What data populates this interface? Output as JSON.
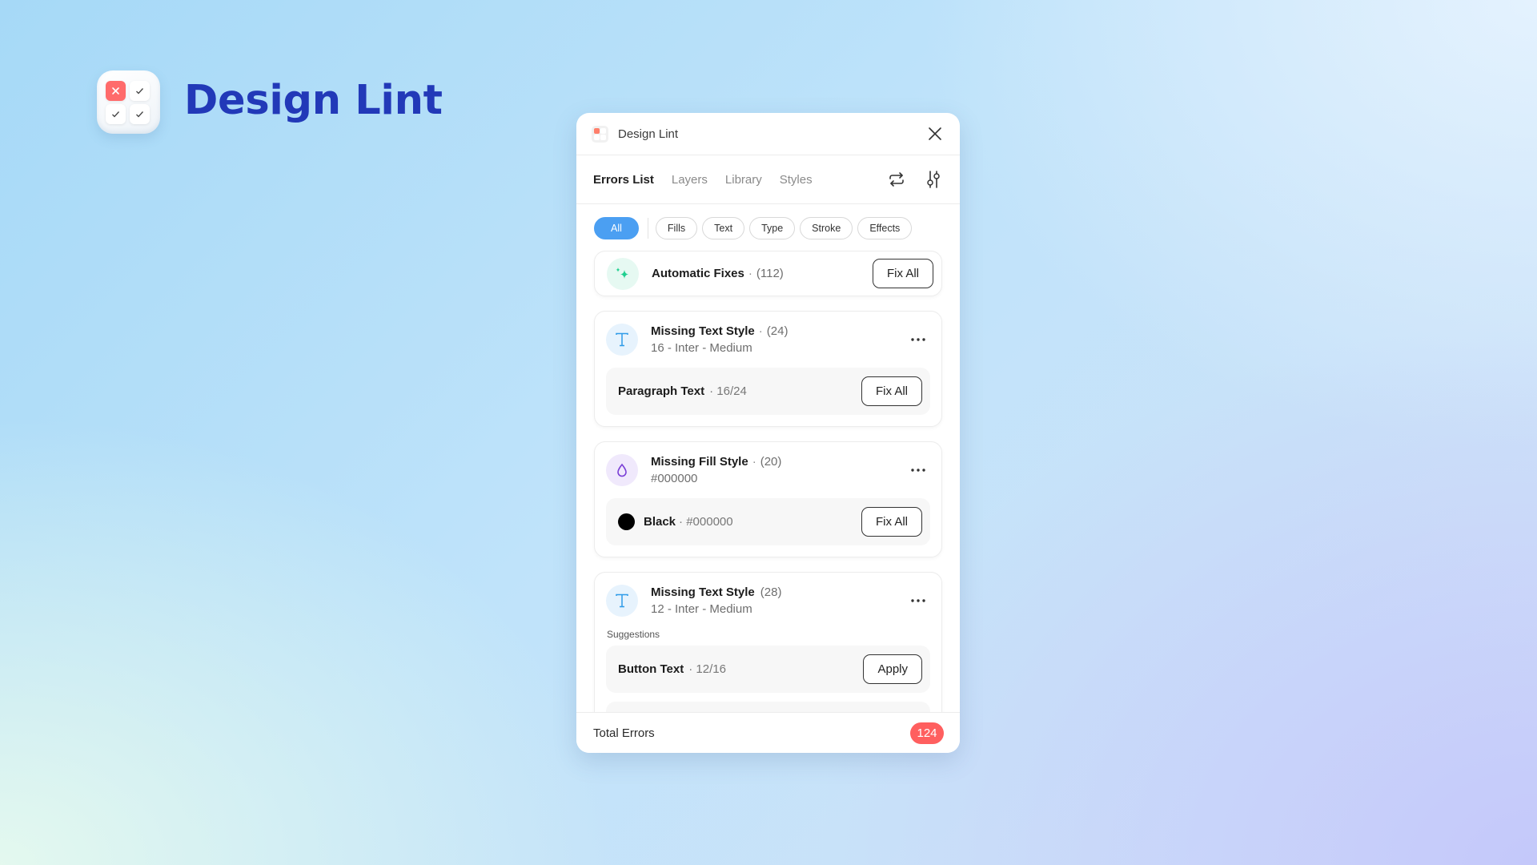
{
  "brand": {
    "title": "Design Lint"
  },
  "panel": {
    "title": "Design Lint",
    "tabs": [
      {
        "label": "Errors List",
        "active": true
      },
      {
        "label": "Layers",
        "active": false
      },
      {
        "label": "Library",
        "active": false
      },
      {
        "label": "Styles",
        "active": false
      }
    ],
    "tools": [
      "refresh-icon",
      "settings-sliders-icon"
    ],
    "filters": [
      {
        "label": "All",
        "active": true
      },
      {
        "label": "Fills",
        "active": false
      },
      {
        "label": "Text",
        "active": false
      },
      {
        "label": "Type",
        "active": false
      },
      {
        "label": "Stroke",
        "active": false
      },
      {
        "label": "Effects",
        "active": false
      }
    ],
    "auto_fixes": {
      "title": "Automatic Fixes",
      "separator": "·",
      "count": "(112)",
      "button": "Fix All",
      "icon": "sparkle-icon"
    },
    "issues": [
      {
        "icon": "text-type-icon",
        "title": "Missing Text Style",
        "separator": "·",
        "count": "(24)",
        "subtitle": "16 - Inter - Medium",
        "suggestion": {
          "name": "Paragraph Text",
          "meta": "· 16/24",
          "button": "Fix All"
        }
      },
      {
        "icon": "fill-drop-icon",
        "title": "Missing Fill Style",
        "separator": "·",
        "count": "(20)",
        "subtitle": "#000000",
        "suggestion": {
          "name": "Black",
          "meta": "· #000000",
          "button": "Fix All",
          "swatch": "#000000"
        }
      },
      {
        "icon": "text-type-icon",
        "title": "Missing Text Style",
        "separator": "",
        "count": "(28)",
        "subtitle": "12 - Inter - Medium",
        "suggestions_label": "Suggestions",
        "suggestion": {
          "name": "Button Text",
          "meta": "· 12/16",
          "button": "Apply"
        }
      }
    ],
    "footer": {
      "label": "Total Errors",
      "count": "124"
    }
  },
  "colors": {
    "accent": "#4b9ff2",
    "brand_title": "#2239b8",
    "error_badge": "#ff5f5f",
    "logo_error": "#ff6b6b",
    "sparkle": "#1fcf8f",
    "text_icon": "#2f9be8",
    "fill_icon": "#7a3fd6"
  }
}
